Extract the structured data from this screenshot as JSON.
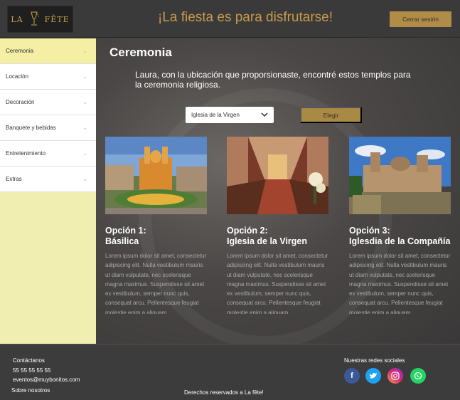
{
  "header": {
    "logo_left": "LA",
    "logo_right": "FÊTE",
    "tagline": "¡La fiesta es para disfrutarse!",
    "logout_label": "Cerrar sesión"
  },
  "sidebar": {
    "items": [
      {
        "label": "Ceremonia"
      },
      {
        "label": "Locación"
      },
      {
        "label": "Decoración"
      },
      {
        "label": "Banquete y bebidas"
      },
      {
        "label": "Entretenimiento"
      },
      {
        "label": "Extras"
      }
    ]
  },
  "main": {
    "title": "Ceremonia",
    "intro": "Laura, con la ubicación que proporsionaste, encontré estos templos para la ceremonia religiosa.",
    "select_value": "Iglesia de la Virgen",
    "choose_label": "Elegir",
    "cards": [
      {
        "title_line1": "Opción 1:",
        "title_line2": "Básilica",
        "text": "Lorem ipsum dolor sit amet, consectetur adipiscing elit. Nulla vestibulum mauris ut diam vulputate, nec scelerisque magna maximus. Suspendisse sit amet ex vestibulum, semper nunc quis, consequat arcu. Pellentesque feugiat molestie enim a aliquam."
      },
      {
        "title_line1": "Opción 2:",
        "title_line2": "Iglesia de la Virgen",
        "text": "Lorem ipsum dolor sit amet, consectetur adipiscing elit. Nulla vestibulum mauris ut diam vulputate, nec scelerisque magna maximus. Suspendisse sit amet ex vestibulum, semper nunc quis, consequat arcu. Pellentesque feugiat molestie enim a aliquam."
      },
      {
        "title_line1": "Opción 3:",
        "title_line2": "Iglesdia de la Compañía",
        "text": "Lorem ipsum dolor sit amet, consectetur adipiscing elit. Nulla vestibulum mauris ut diam vulputate, nec scelerisque magna maximus. Suspendisse sit amet ex vestibulum, semper nunc quis, consequat arcu. Pellentesque feugiat molestie enim a aliquam."
      }
    ]
  },
  "footer": {
    "contact_title": "Contáctanos",
    "phone": "55 55 55 55 55",
    "email": "eventos@muybonitos.com",
    "about": "Sobre nosotros",
    "rights": "Derechos reservados a La fête!",
    "social_title": "Nuestras redes sociales",
    "social_icons": [
      "facebook-icon",
      "twitter-icon",
      "instagram-icon",
      "whatsapp-icon"
    ]
  },
  "colors": {
    "accent_gold": "#b08d47",
    "sidebar_active": "#f4efa4",
    "sidebar_bg": "#f1eeb1"
  }
}
